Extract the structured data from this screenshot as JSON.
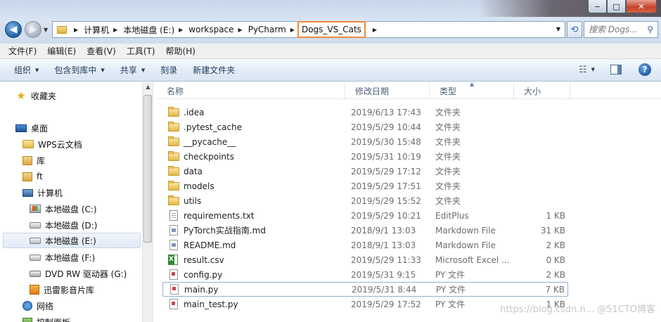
{
  "window": {
    "minimize_glyph": "−",
    "maximize_glyph": "□",
    "close_glyph": "✕"
  },
  "address": {
    "crumbs": [
      "计算机",
      "本地磁盘 (E:)",
      "workspace",
      "PyCharm",
      "Dogs_VS_Cats"
    ],
    "search_placeholder": "搜索 Dogs..."
  },
  "menu": [
    "文件(F)",
    "编辑(E)",
    "查看(V)",
    "工具(T)",
    "帮助(H)"
  ],
  "commands": [
    "组织",
    "包含到库中",
    "共享",
    "刻录",
    "新建文件夹"
  ],
  "nav": {
    "favorites": "收藏夹",
    "desktop": "桌面",
    "wps": "WPS云文档",
    "libraries": "库",
    "ft": "ft",
    "computer": "计算机",
    "drive_c": "本地磁盘 (C:)",
    "drive_d": "本地磁盘 (D:)",
    "drive_e": "本地磁盘 (E:)",
    "drive_f": "本地磁盘 (F:)",
    "dvd": "DVD RW 驱动器 (G:)",
    "xunlei": "迅雷影音片库",
    "network": "网络",
    "control_panel": "控制面板"
  },
  "columns": {
    "name": "名称",
    "date": "修改日期",
    "type": "类型",
    "size": "大小"
  },
  "files": [
    {
      "name": ".idea",
      "date": "2019/6/13 17:43",
      "type": "文件夹",
      "size": "",
      "icon": "folder-icon"
    },
    {
      "name": ".pytest_cache",
      "date": "2019/5/29 10:44",
      "type": "文件夹",
      "size": "",
      "icon": "folder-icon"
    },
    {
      "name": "__pycache__",
      "date": "2019/5/30 15:48",
      "type": "文件夹",
      "size": "",
      "icon": "folder-icon"
    },
    {
      "name": "checkpoints",
      "date": "2019/5/31 10:19",
      "type": "文件夹",
      "size": "",
      "icon": "folder-icon"
    },
    {
      "name": "data",
      "date": "2019/5/29 17:12",
      "type": "文件夹",
      "size": "",
      "icon": "folder-icon"
    },
    {
      "name": "models",
      "date": "2019/5/29 17:51",
      "type": "文件夹",
      "size": "",
      "icon": "folder-icon"
    },
    {
      "name": "utils",
      "date": "2019/5/29 15:52",
      "type": "文件夹",
      "size": "",
      "icon": "folder-icon"
    },
    {
      "name": "requirements.txt",
      "date": "2019/5/29 10:21",
      "type": "EditPlus",
      "size": "1 KB",
      "icon": "text-file-icon"
    },
    {
      "name": "PyTorch实战指南.md",
      "date": "2018/9/1 13:03",
      "type": "Markdown File",
      "size": "31 KB",
      "icon": "markdown-file-icon"
    },
    {
      "name": "README.md",
      "date": "2018/9/1 13:03",
      "type": "Markdown File",
      "size": "2 KB",
      "icon": "markdown-file-icon"
    },
    {
      "name": "result.csv",
      "date": "2019/5/29 11:33",
      "type": "Microsoft Excel ...",
      "size": "0 KB",
      "icon": "excel-csv-icon"
    },
    {
      "name": "config.py",
      "date": "2019/5/31 9:15",
      "type": "PY 文件",
      "size": "2 KB",
      "icon": "python-file-icon"
    },
    {
      "name": "main.py",
      "date": "2019/5/31 8:44",
      "type": "PY 文件",
      "size": "7 KB",
      "icon": "python-file-icon"
    },
    {
      "name": "main_test.py",
      "date": "2019/5/29 17:52",
      "type": "PY 文件",
      "size": "1 KB",
      "icon": "python-file-icon"
    }
  ],
  "watermark": "https://blog.csdn.n... @51CTO博客"
}
